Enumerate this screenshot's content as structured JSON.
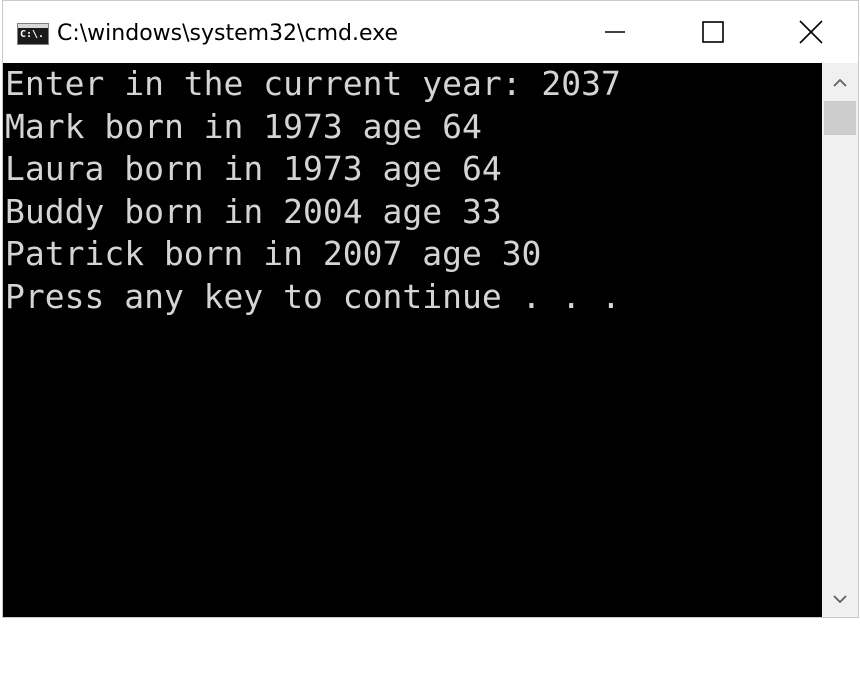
{
  "window": {
    "title": "C:\\windows\\system32\\cmd.exe",
    "icon_label": "C:\\."
  },
  "controls": {
    "minimize": "minimize-icon",
    "maximize": "maximize-icon",
    "close": "close-icon"
  },
  "console": {
    "lines": [
      "Enter in the current year: 2037",
      "Mark born in 1973 age 64",
      "Laura born in 1973 age 64",
      "Buddy born in 2004 age 33",
      "Patrick born in 2007 age 30",
      "Press any key to continue . . ."
    ],
    "colors": {
      "background": "#000000",
      "foreground": "#d4d4d4"
    }
  },
  "scrollbar": {
    "up_icon": "chevron-up-icon",
    "down_icon": "chevron-down-icon"
  }
}
